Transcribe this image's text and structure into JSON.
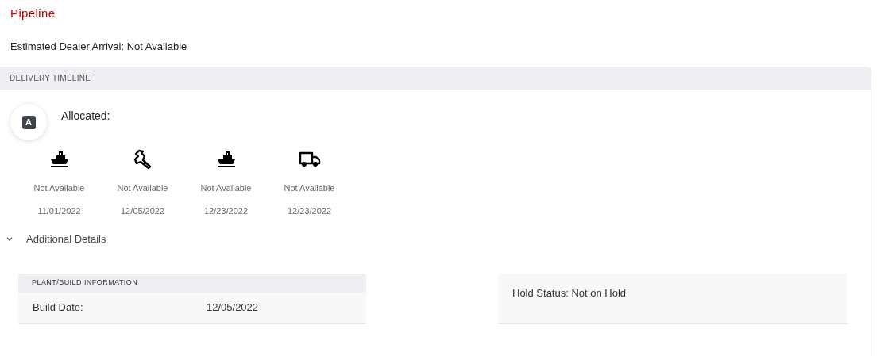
{
  "title": "Pipeline",
  "estimated_arrival": "Estimated Dealer Arrival: Not Available",
  "delivery_timeline": {
    "header": "DELIVERY TIMELINE",
    "status_badge": "A",
    "status_label": "Allocated:",
    "milestones": [
      {
        "kind": "ship",
        "status": "Not Available",
        "date": "11/01/2022"
      },
      {
        "kind": "wrench",
        "status": "Not Available",
        "date": "12/05/2022"
      },
      {
        "kind": "ship",
        "status": "Not Available",
        "date": "12/23/2022"
      },
      {
        "kind": "truck",
        "status": "Not Available",
        "date": "12/23/2022"
      }
    ]
  },
  "additional_details": {
    "label": "Additional Details",
    "expanded": true
  },
  "plant_build": {
    "header": "PLANT/BUILD INFORMATION",
    "rows": [
      {
        "label": "Build Date:",
        "value": "12/05/2022"
      }
    ]
  },
  "hold_status": "Hold Status: Not on Hold"
}
